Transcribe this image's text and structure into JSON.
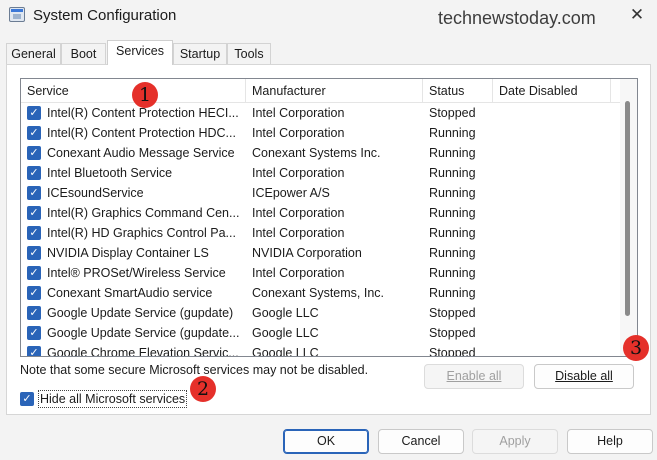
{
  "window": {
    "title": "System Configuration",
    "watermark": "technewstoday.com",
    "close_symbol": "✕"
  },
  "tabs": [
    {
      "label": "General",
      "active": false
    },
    {
      "label": "Boot",
      "active": false
    },
    {
      "label": "Services",
      "active": true
    },
    {
      "label": "Startup",
      "active": false
    },
    {
      "label": "Tools",
      "active": false
    }
  ],
  "services_list": {
    "columns": [
      "Service",
      "Manufacturer",
      "Status",
      "Date Disabled"
    ],
    "rows": [
      {
        "checked": true,
        "service": "Intel(R) Content Protection HECI...",
        "manufacturer": "Intel Corporation",
        "status": "Stopped",
        "date_disabled": ""
      },
      {
        "checked": true,
        "service": "Intel(R) Content Protection HDC...",
        "manufacturer": "Intel Corporation",
        "status": "Running",
        "date_disabled": ""
      },
      {
        "checked": true,
        "service": "Conexant Audio Message Service",
        "manufacturer": "Conexant Systems Inc.",
        "status": "Running",
        "date_disabled": ""
      },
      {
        "checked": true,
        "service": "Intel Bluetooth Service",
        "manufacturer": "Intel Corporation",
        "status": "Running",
        "date_disabled": ""
      },
      {
        "checked": true,
        "service": "ICEsoundService",
        "manufacturer": "ICEpower A/S",
        "status": "Running",
        "date_disabled": ""
      },
      {
        "checked": true,
        "service": "Intel(R) Graphics Command Cen...",
        "manufacturer": "Intel Corporation",
        "status": "Running",
        "date_disabled": ""
      },
      {
        "checked": true,
        "service": "Intel(R) HD Graphics Control Pa...",
        "manufacturer": "Intel Corporation",
        "status": "Running",
        "date_disabled": ""
      },
      {
        "checked": true,
        "service": "NVIDIA Display Container LS",
        "manufacturer": "NVIDIA Corporation",
        "status": "Running",
        "date_disabled": ""
      },
      {
        "checked": true,
        "service": "Intel® PROSet/Wireless Service",
        "manufacturer": "Intel Corporation",
        "status": "Running",
        "date_disabled": ""
      },
      {
        "checked": true,
        "service": "Conexant SmartAudio service",
        "manufacturer": "Conexant Systems, Inc.",
        "status": "Running",
        "date_disabled": ""
      },
      {
        "checked": true,
        "service": "Google Update Service (gupdate)",
        "manufacturer": "Google LLC",
        "status": "Stopped",
        "date_disabled": ""
      },
      {
        "checked": true,
        "service": "Google Update Service (gupdate...",
        "manufacturer": "Google LLC",
        "status": "Stopped",
        "date_disabled": ""
      },
      {
        "checked": true,
        "service": "Google Chrome Elevation Servic...",
        "manufacturer": "Google LLC",
        "status": "Stopped",
        "date_disabled": ""
      }
    ]
  },
  "note": "Note that some secure Microsoft services may not be disabled.",
  "buttons": {
    "enable_all": "Enable all",
    "disable_all": "Disable all",
    "ok": "OK",
    "cancel": "Cancel",
    "apply": "Apply",
    "help": "Help"
  },
  "hide_ms": {
    "checked": true,
    "label": "Hide all Microsoft services"
  },
  "annotations": [
    "1",
    "2",
    "3"
  ],
  "colors": {
    "accent": "#2a64b8",
    "marker": "#e5302a"
  }
}
